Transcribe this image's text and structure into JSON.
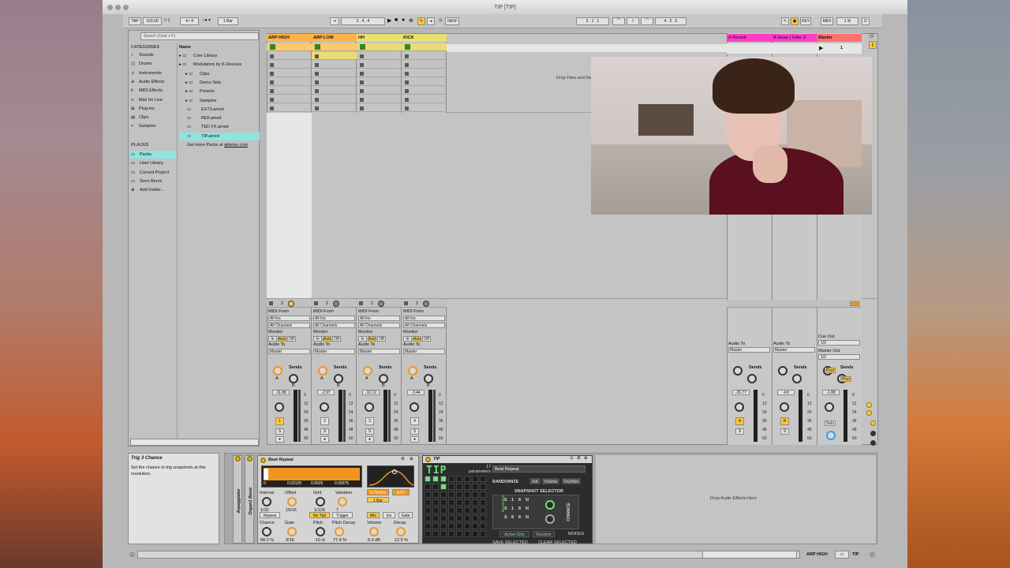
{
  "window": {
    "title": "TIP  [TIP]"
  },
  "control_bar": {
    "tap": "TAP",
    "tempo": "103.00",
    "signature": "4 / 4",
    "quantize": "1 Bar",
    "position": "2 .  4 .  4",
    "new_label": "NEW",
    "loop_start": "3 .  1 .  1",
    "loop_length": "4 .  0 .  0",
    "key_label": "KEY",
    "midi_label": "MIDI",
    "cpu": "1 %",
    "d_label": "D"
  },
  "browser": {
    "search_placeholder": "Search (Cmd + F)",
    "categories_title": "CATEGORIES",
    "categories": [
      "Sounds",
      "Drums",
      "Instruments",
      "Audio Effects",
      "MIDI Effects",
      "Max for Live",
      "Plug-ins",
      "Clips",
      "Samples"
    ],
    "places_title": "PLACES",
    "places": [
      "Packs",
      "User Library",
      "Current Project",
      "Sven Benni",
      "Add Folder..."
    ],
    "name_header": "Name",
    "items": [
      "Core Library",
      "Modulators by K-Devices",
      "Clips",
      "Demo Sets",
      "Presets",
      "Samples",
      "EXT3.amxd",
      "REF.amxd",
      "TED FX.amxd",
      "TIP.amxd"
    ],
    "get_more": "Get more Packs at",
    "get_more_link": "ableton.com"
  },
  "tracks": [
    {
      "name": "ARP HIGH",
      "volume": "-11.88",
      "number": "1",
      "color": "#ffb347"
    },
    {
      "name": "ARP LOW",
      "volume": "-2.97",
      "number": "2",
      "color": "#ffb347"
    },
    {
      "name": "HH",
      "volume": "-10.12",
      "number": "3",
      "color": "#e8e070"
    },
    {
      "name": "KICK",
      "volume": "-3.44",
      "number": "4",
      "color": "#e8e070"
    }
  ],
  "returns": [
    {
      "name": "A Reverb",
      "volume": "-26.77",
      "letter": "A",
      "color": "#ff3cc8"
    },
    {
      "name": "B Delay | Filter D",
      "volume": "-Inf",
      "letter": "B",
      "color": "#ff3cc8"
    },
    {
      "name": "Master",
      "volume": "-1.88",
      "color": "#ff7070"
    }
  ],
  "io": {
    "midi_from": "MIDI From",
    "all_ins": "All Ins",
    "all_channels": "All Channels",
    "monitor": "Monitor",
    "mon_in": "In",
    "mon_auto": "Auto",
    "mon_off": "Off",
    "audio_to": "Audio To",
    "master": "Master",
    "sends": "Sends",
    "send_a": "A",
    "send_b": "B",
    "cue_out": "Cue Out",
    "cue_val": "1/2",
    "master_out": "Master Out",
    "master_val": "1/2",
    "post": "Post",
    "solo": "Solo",
    "s_label": "S",
    "master_slot": "1",
    "scale": [
      "0",
      "12",
      "24",
      "36",
      "48",
      "60"
    ]
  },
  "drop_files": "Drop Files and Devices Here",
  "info": {
    "title": "Trig 3 Chance",
    "body": "Set the chance to trig snapshots at this resolution."
  },
  "device_chain": {
    "arpeggiator": "Arpeggiator",
    "organ": "Organ1 Basic"
  },
  "beat_repeat": {
    "title": "Beat Repeat",
    "display": [
      "0",
      "0.03125",
      "0.0625",
      "0.09375"
    ],
    "freq": "5.79 kHz",
    "width": "6.07",
    "labels": [
      "Interval",
      "Offset",
      "Grid",
      "Variation"
    ],
    "values": [
      "1/32",
      "10/16",
      "1/128",
      "7"
    ],
    "repeat": "Repeat",
    "no_trpl": "No Trpl",
    "trigger": "Trigger",
    "one_bar": "1 Bar",
    "mix": "Mix",
    "ins": "Ins",
    "gate": "Gate",
    "labels2": [
      "Chance",
      "Gate",
      "Pitch",
      "Pitch Decay",
      "Volume",
      "Decay"
    ],
    "values2": [
      "88.3 %",
      "3/16",
      "-10 st",
      "77.4 %",
      "6.0 dB",
      "12.5 %"
    ]
  },
  "tip": {
    "title": "TIP",
    "logo": "TIP",
    "params_count": "17",
    "params_label": "parameters",
    "target": "Beat Repeat",
    "randomize": "RANDOMIZE",
    "init": "Init",
    "volume": "Volume",
    "drywet": "Dry/Wet",
    "snapshot_selector": "SNAPSHOT SELECTOR",
    "rows": [
      [
        "S",
        "1",
        "8",
        "N"
      ],
      [
        "S",
        "1",
        "8",
        "N"
      ],
      [
        "S",
        "8",
        "8",
        "N"
      ]
    ],
    "chance": "CHANCE",
    "active_only": "Active Only",
    "random": "Random",
    "modes": "MODES",
    "save_selected": "SAVE SELECTED",
    "clear_selected": "CLEAR SELECTED",
    "resolution": "Resolution"
  },
  "drop_audio": "Drop Audio Effects Here",
  "status": {
    "track": "ARP HIGH",
    "tip": "TIP"
  }
}
